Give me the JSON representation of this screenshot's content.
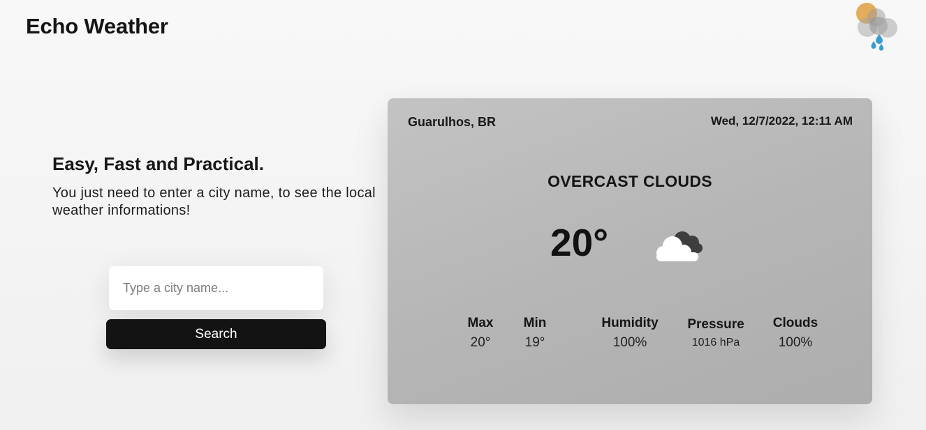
{
  "app": {
    "title": "Echo Weather"
  },
  "intro": {
    "heading": "Easy, Fast and Practical.",
    "text": "You just need to enter a city name, to see the local weather informations!"
  },
  "search": {
    "placeholder": "Type a city name...",
    "value": "",
    "button_label": "Search"
  },
  "weather": {
    "location": "Guarulhos, BR",
    "datetime": "Wed, 12/7/2022, 12:11 AM",
    "condition": "OVERCAST CLOUDS",
    "temperature": "20°",
    "icon": "overcast-clouds-icon",
    "stats": {
      "max": {
        "label": "Max",
        "value": "20°"
      },
      "min": {
        "label": "Min",
        "value": "19°"
      },
      "humidity": {
        "label": "Humidity",
        "value": "100%"
      },
      "pressure": {
        "label": "Pressure",
        "value": "1016 hPa"
      },
      "clouds": {
        "label": "Clouds",
        "value": "100%"
      }
    }
  },
  "colors": {
    "background": "#f4f4f4",
    "card": "#b8b8b8",
    "button": "#131313",
    "button_text": "#ffffff",
    "logo_sun": "#e0a040",
    "logo_rain": "#3a9cd0"
  }
}
